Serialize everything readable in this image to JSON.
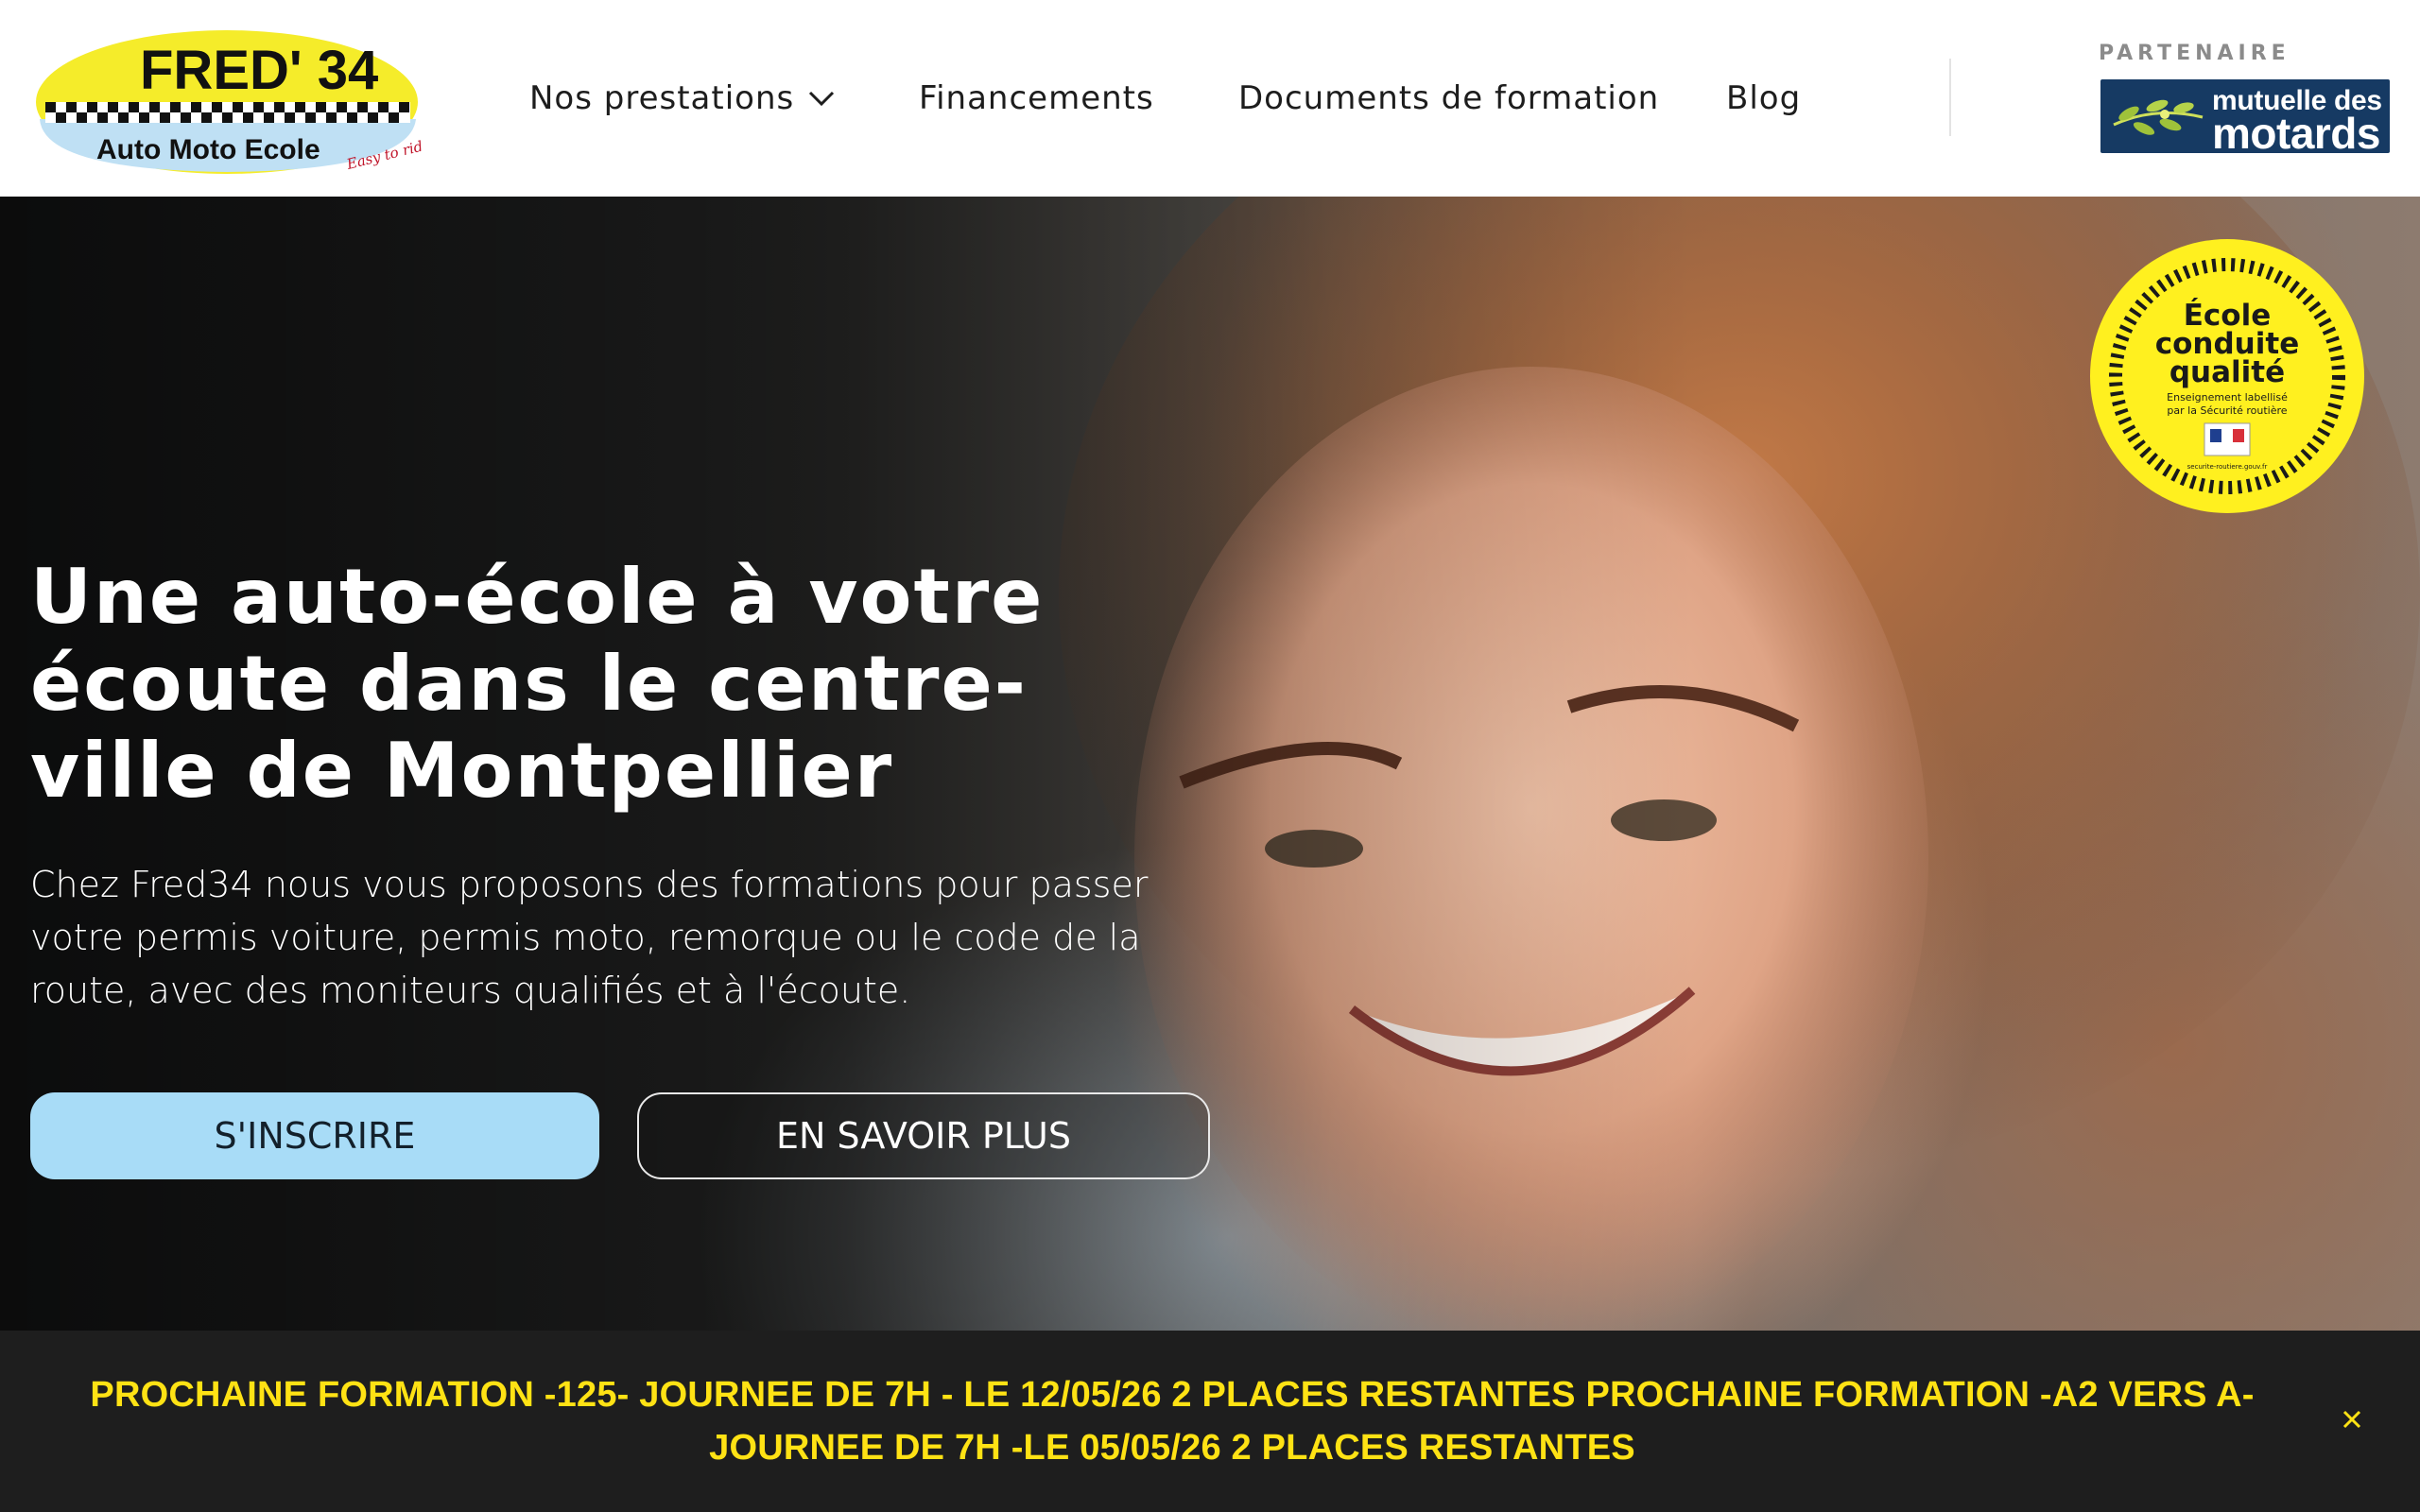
{
  "header": {
    "logo": {
      "brand": "FRED' 34",
      "subtitle": "Auto Moto Ecole",
      "tagline": "Easy to ride!"
    },
    "nav": [
      {
        "label": "Nos prestations",
        "has_dropdown": true,
        "icon": "chevron-down-icon"
      },
      {
        "label": "Financements"
      },
      {
        "label": "Documents de formation"
      },
      {
        "label": "Blog"
      }
    ],
    "partner": {
      "label": "PARTENAIRE",
      "name_line1": "mutuelle des",
      "name_line2": "motards",
      "color": "#163a63"
    }
  },
  "hero": {
    "title": "Une auto-école à votre écoute dans le centre-ville de Montpellier",
    "text": "Chez Fred34 nous vous proposons des formations pour passer votre permis voiture, permis moto, remorque ou le code de la route, avec des moniteurs qualifiés et à l'écoute.",
    "primary_button": "S'INSCRIRE",
    "secondary_button": "EN SAVOIR PLUS",
    "badge": {
      "line1": "École",
      "line2": "conduite",
      "line3": "qualité",
      "caption1": "Enseignement labellisé",
      "caption2": "par la Sécurité routière",
      "footer": "securite-routiere.gouv.fr",
      "color": "#fff01f"
    }
  },
  "banner": {
    "text": "PROCHAINE FORMATION -125- JOURNEE DE 7H - LE 12/05/26 2 PLACES RESTANTES PROCHAINE FORMATION -A2 VERS A- JOURNEE DE 7H -LE 05/05/26 2 PLACES RESTANTES",
    "text_color": "#ffe214",
    "close_icon": "close-icon"
  }
}
